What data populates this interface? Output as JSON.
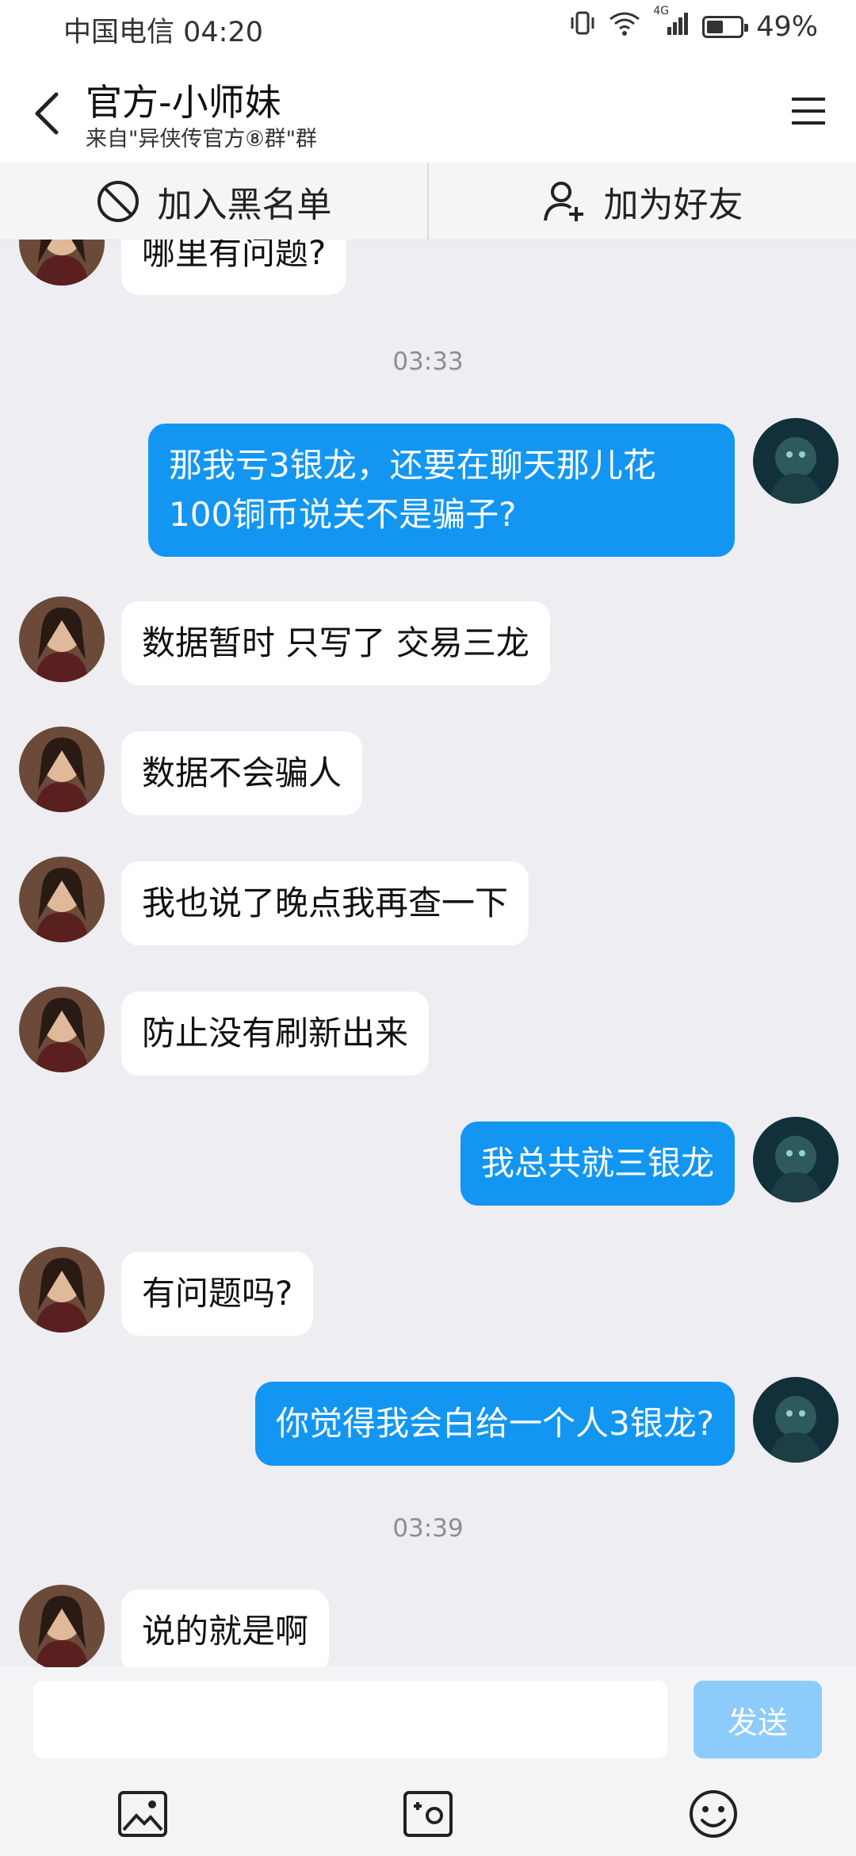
{
  "status_bar": {
    "carrier_time": "中国电信 04:20",
    "network_label": "4G",
    "battery_percent": "49%",
    "battery_level": 0.49
  },
  "header": {
    "title": "官方-小师妹",
    "subtitle": "来自\"异侠传官方⑧群\"群",
    "back_icon": "back-arrow-icon",
    "menu_icon": "hamburger-menu-icon"
  },
  "actions": {
    "blacklist_label": "加入黑名单",
    "add_friend_label": "加为好友"
  },
  "messages": [
    {
      "side": "in",
      "text": "哪里有问题?"
    },
    {
      "type": "time",
      "text": "03:33"
    },
    {
      "side": "out",
      "lines": [
        "那我亏3银龙，还要在聊天那儿花",
        "100铜币说关不是骗子?"
      ]
    },
    {
      "side": "in",
      "text": "数据暂时 只写了 交易三龙"
    },
    {
      "side": "in",
      "text": "数据不会骗人"
    },
    {
      "side": "in",
      "text": "我也说了晚点我再查一下"
    },
    {
      "side": "in",
      "text": "防止没有刷新出来"
    },
    {
      "side": "out",
      "text": "我总共就三银龙"
    },
    {
      "side": "in",
      "text": "有问题吗?"
    },
    {
      "side": "out",
      "text": "你觉得我会白给一个人3银龙?"
    },
    {
      "type": "time",
      "text": "03:39"
    },
    {
      "side": "in",
      "text": "说的就是啊"
    }
  ],
  "input": {
    "placeholder": "",
    "send_label": "发送"
  },
  "colors": {
    "accent": "#1296f2",
    "send_disabled": "#8ccbfa",
    "chat_bg": "#ededf2"
  }
}
